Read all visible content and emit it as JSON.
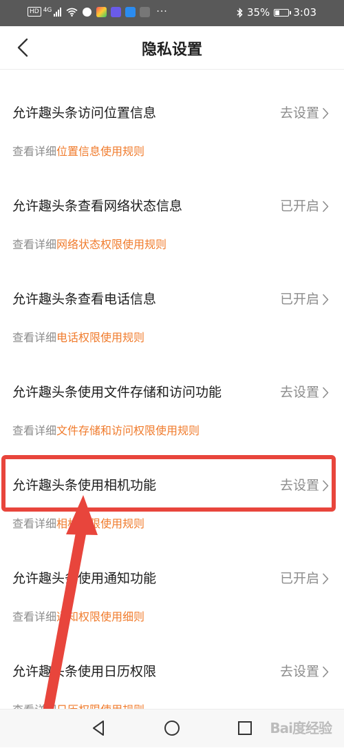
{
  "status_bar": {
    "network_badge": "HD",
    "network_type": "4G",
    "battery": "35%",
    "battery_level": 0.35,
    "time": "3:03",
    "more": "···"
  },
  "header": {
    "title": "隐私设置",
    "back_icon": "chevron-left-icon"
  },
  "permissions": [
    {
      "title": "允许趣头条访问位置信息",
      "action": "去设置",
      "sub_prefix": "查看详细",
      "sub_link": "位置信息使用规则"
    },
    {
      "title": "允许趣头条查看网络状态信息",
      "action": "已开启",
      "sub_prefix": "查看详细",
      "sub_link": "网络状态权限使用规则"
    },
    {
      "title": "允许趣头条查看电话信息",
      "action": "已开启",
      "sub_prefix": "查看详细",
      "sub_link": "电话权限使用规则"
    },
    {
      "title": "允许趣头条使用文件存储和访问功能",
      "action": "去设置",
      "sub_prefix": "查看详细",
      "sub_link": "文件存储和访问权限使用规则"
    },
    {
      "title": "允许趣头条使用相机功能",
      "action": "去设置",
      "sub_prefix": "查看详细",
      "sub_link": "相机权限使用规则"
    },
    {
      "title": "允许趣头条使用通知功能",
      "action": "已开启",
      "sub_prefix": "查看详细",
      "sub_link": "通知权限使用细则"
    },
    {
      "title": "允许趣头条使用日历权限",
      "action": "去设置",
      "sub_prefix": "查看详细",
      "sub_link": "日历权限使用规则"
    }
  ],
  "watermark": "Bai度经验",
  "colors": {
    "status_bar_bg": "#595959",
    "link": "#f07b2c",
    "annotation_red": "#e8453c",
    "secondary_text": "#8c8c8c"
  },
  "icons": {
    "action_chevron": "chevron-right-icon",
    "nav_back": "triangle-back-icon",
    "nav_home": "circle-home-icon",
    "nav_recents": "square-recents-icon"
  }
}
